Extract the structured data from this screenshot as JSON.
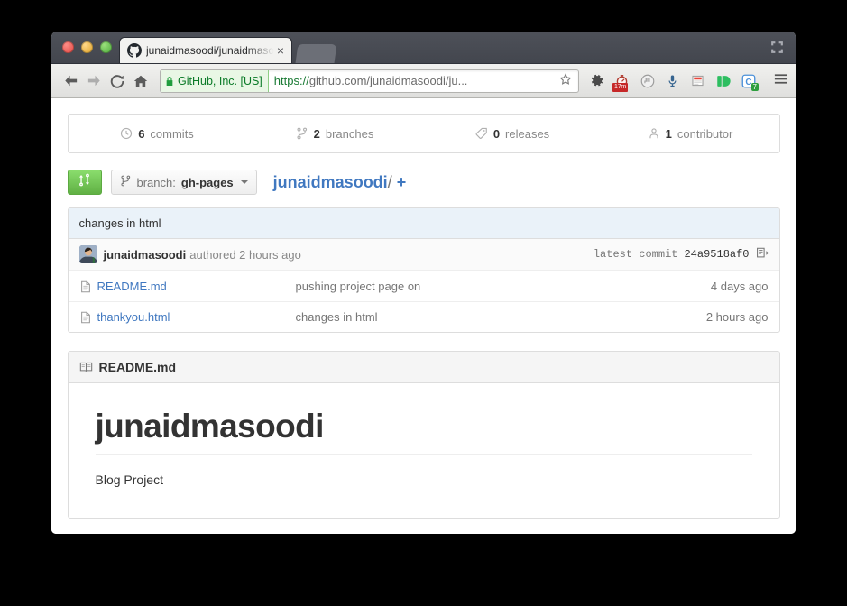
{
  "window": {
    "fullscreen_icon": "fullscreen-arrows-icon",
    "traffic_lights": [
      "close",
      "minimize",
      "zoom"
    ]
  },
  "tab": {
    "favicon": "github-octocat-icon",
    "title": "junaidmasoodi/junaidmaso",
    "close_label": "×"
  },
  "toolbar": {
    "back_icon": "back-arrow-icon",
    "forward_icon": "forward-arrow-icon",
    "reload_icon": "reload-icon",
    "home_icon": "home-icon",
    "ev_certificate": "GitHub, Inc. [US]",
    "url_scheme": "https://",
    "url_rest": "github.com/junaidmasoodi/ju...",
    "bookmark_icon": "star-icon",
    "extensions": [
      {
        "name": "gear-extension-icon"
      },
      {
        "name": "timer-extension-icon",
        "badge": "17m"
      },
      {
        "name": "blocker-extension-icon"
      },
      {
        "name": "microphone-extension-icon"
      },
      {
        "name": "notes-extension-icon"
      },
      {
        "name": "evernote-extension-icon"
      },
      {
        "name": "clipboard-extension-icon",
        "badge": "7"
      }
    ],
    "menu_icon": "hamburger-menu-icon"
  },
  "repo_stats": [
    {
      "icon": "history-icon",
      "count": "6",
      "label": "commits"
    },
    {
      "icon": "branch-icon",
      "count": "2",
      "label": "branches"
    },
    {
      "icon": "tag-icon",
      "count": "0",
      "label": "releases"
    },
    {
      "icon": "people-icon",
      "count": "1",
      "label": "contributor"
    }
  ],
  "branch_row": {
    "compare_icon": "pull-request-icon",
    "branch_prefix": "branch:",
    "branch_name": "gh-pages",
    "repo_link": "junaidmasoodi",
    "separator": "/",
    "add_file": "+"
  },
  "latest_commit": {
    "message": "changes in html",
    "author": "junaidmasoodi",
    "action": "authored 2 hours ago",
    "label": "latest commit",
    "sha": "24a9518af0",
    "copy_icon": "clipboard-copy-icon"
  },
  "files": [
    {
      "icon": "file-icon",
      "name": "README.md",
      "message": "pushing project page on",
      "age": "4 days ago"
    },
    {
      "icon": "file-icon",
      "name": "thankyou.html",
      "message": "changes in html",
      "age": "2 hours ago"
    }
  ],
  "readme": {
    "icon": "book-icon",
    "title": "README.md",
    "heading": "junaidmasoodi",
    "paragraph": "Blog Project"
  },
  "colors": {
    "link": "#4078c0",
    "green_button": "#60b044",
    "commit_bar": "#eaf2f9",
    "ev_green": "#0a7a27",
    "border": "#dddddd"
  }
}
